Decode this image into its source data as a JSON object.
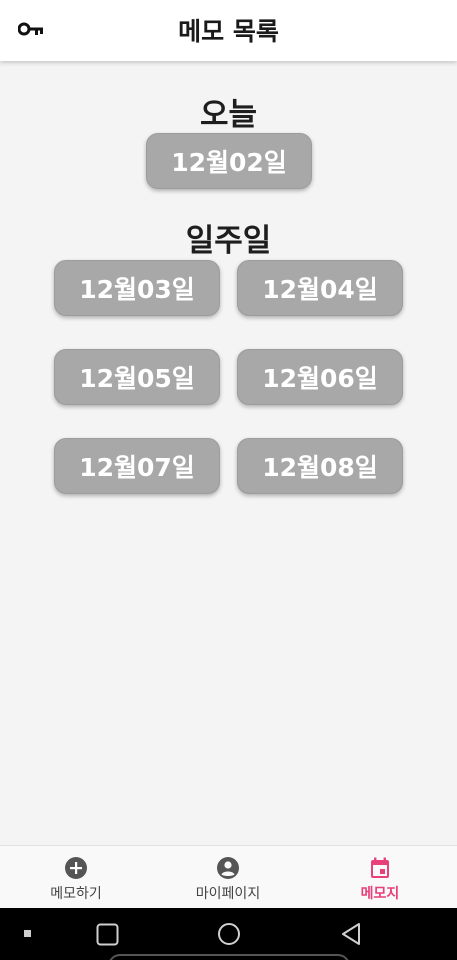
{
  "app_bar": {
    "title": "메모 목록",
    "left_icon": "key-icon"
  },
  "today": {
    "title": "오늘",
    "date": "12월02일"
  },
  "week": {
    "title": "일주일",
    "dates": [
      "12월03일",
      "12월04일",
      "12월05일",
      "12월06일",
      "12월07일",
      "12월08일"
    ]
  },
  "bottom_nav": {
    "items": [
      {
        "label": "메모하기",
        "icon": "add-circle-icon",
        "active": false
      },
      {
        "label": "마이페이지",
        "icon": "account-circle-icon",
        "active": false
      },
      {
        "label": "메모지",
        "icon": "calendar-icon",
        "active": true
      }
    ]
  },
  "system_nav": {
    "buttons": [
      "recent-apps-icon",
      "home-icon",
      "back-icon"
    ]
  },
  "colors": {
    "accent": "#e8407a",
    "button_bg": "#a8a8a8",
    "background": "#f4f4f4"
  }
}
